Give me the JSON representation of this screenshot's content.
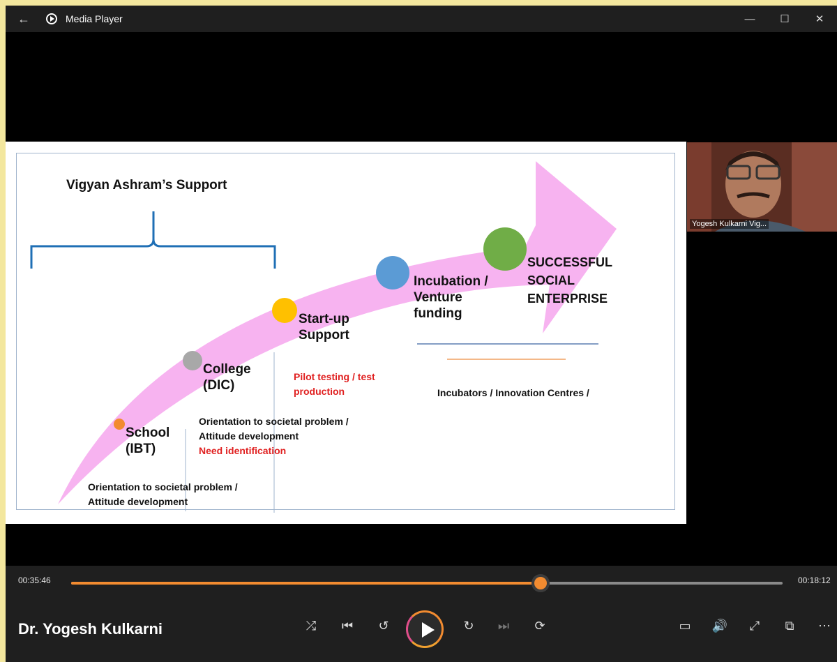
{
  "window": {
    "title": "Media Player",
    "back_glyph": "←",
    "minimize_glyph": "—",
    "maximize_glyph": "☐",
    "close_glyph": "✕"
  },
  "slide": {
    "heading": "Vigyan Ashram’s Support",
    "stages": {
      "school_line1": "School",
      "school_line2": "(IBT)",
      "college_line1": "College",
      "college_line2": "(DIC)",
      "startup_line1": "Start-up",
      "startup_line2": "Support",
      "incubation_line1": "Incubation /",
      "incubation_line2": "Venture",
      "incubation_line3": "funding",
      "success_line1": "SUCCESSFUL",
      "success_line2": "SOCIAL",
      "success_line3": "ENTERPRISE"
    },
    "notes": {
      "school_note1": "Orientation to societal problem /",
      "school_note2": "Attitude development",
      "college_note1": "Orientation to societal problem /",
      "college_note2": "Attitude development",
      "college_note3": "Need identification",
      "startup_note1": "Pilot testing / test",
      "startup_note2": "production",
      "incubation_note": "Incubators / Innovation Centres /"
    },
    "colors": {
      "arrow": "#f7b3f0",
      "brace": "#1f6fb5",
      "dot_school": "#f28b30",
      "dot_college": "#a8a8a8",
      "dot_startup": "#ffc000",
      "dot_incubation": "#5b9bd5",
      "dot_success": "#70ad47",
      "red_text": "#e02020"
    }
  },
  "participant": {
    "name": "Yogesh Kulkarni Vig..."
  },
  "player": {
    "elapsed": "00:35:46",
    "remaining": "00:18:12",
    "progress_fraction": 0.66,
    "now_playing": "Dr. Yogesh Kulkarni",
    "accent": "#f28b30",
    "icons": {
      "shuffle": "⤮",
      "previous": "⏮",
      "rewind10": "↺",
      "forward30": "↻",
      "next": "⏭",
      "repeat": "⟳",
      "subtitles": "▭",
      "volume": "🔊",
      "fullscreen": "⤢",
      "miniplayer": "⧉",
      "more": "⋯"
    }
  }
}
